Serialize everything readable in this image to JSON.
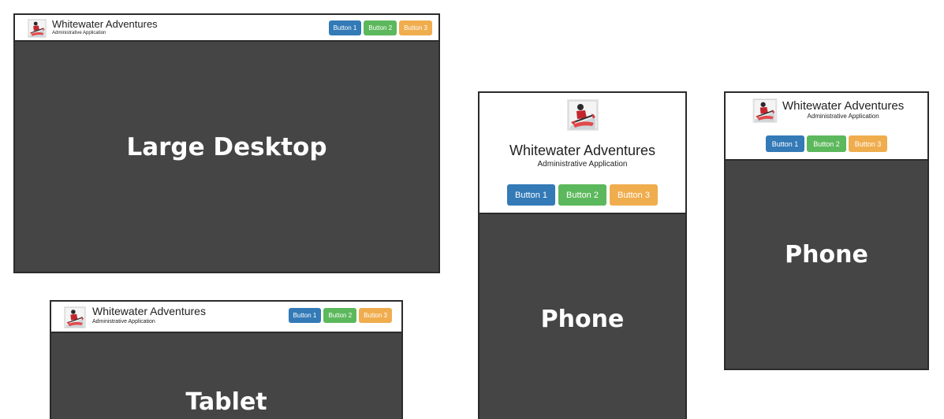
{
  "brand": {
    "title": "Whitewater Adventures",
    "subtitle": "Administrative Application"
  },
  "buttons": [
    {
      "label": "Button 1",
      "color": "#337ab7"
    },
    {
      "label": "Button 2",
      "color": "#5cb85c"
    },
    {
      "label": "Button 3",
      "color": "#f0ad4e"
    }
  ],
  "viewports": {
    "desktop": {
      "label": "Large Desktop"
    },
    "tablet": {
      "label": "Tablet"
    },
    "phone_portrait": {
      "label": "Phone"
    },
    "phone_small": {
      "label": "Phone"
    }
  },
  "colors": {
    "content_bg": "#454545",
    "frame_border": "#2b2b2b",
    "header_bg": "#ffffff"
  },
  "icons": {
    "logo": "kayaker-logo-icon"
  }
}
